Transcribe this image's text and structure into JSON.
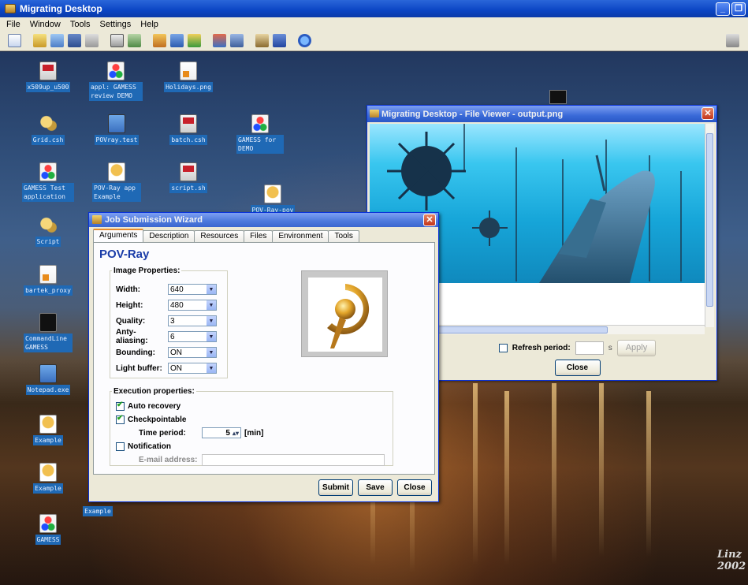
{
  "app": {
    "title": "Migrating Desktop"
  },
  "menu": [
    "File",
    "Window",
    "Tools",
    "Settings",
    "Help"
  ],
  "desktop_icons": [
    {
      "label": "x509up_u500",
      "kind": "pdf"
    },
    {
      "label": "appl: GAMESS review DEMO",
      "kind": "person"
    },
    {
      "label": "Holidays.png",
      "kind": "img"
    },
    {
      "label": "Grid.csh",
      "kind": "puzzle"
    },
    {
      "label": "POVray.test",
      "kind": "note"
    },
    {
      "label": "batch.csh",
      "kind": "pdf"
    },
    {
      "label": "GAMESS for DEMO",
      "kind": "person"
    },
    {
      "label": "GAMESS Test application",
      "kind": "person"
    },
    {
      "label": "POV-Ray app Example",
      "kind": "pov"
    },
    {
      "label": "script.sh",
      "kind": "pdf"
    },
    {
      "label": "POV-Ray-pov",
      "kind": "pov"
    },
    {
      "label": "Script",
      "kind": "puzzle"
    },
    {
      "label": "bartek_proxy",
      "kind": "img"
    },
    {
      "label": "CommandLine GAMESS",
      "kind": "term"
    },
    {
      "label": "Notepad.exe",
      "kind": "note"
    },
    {
      "label": "Example",
      "kind": "pov"
    },
    {
      "label": "Example",
      "kind": "pov"
    },
    {
      "label": "Example",
      "kind": "pov"
    },
    {
      "label": "GAMESS",
      "kind": "person"
    }
  ],
  "file_viewer": {
    "title": "Migrating Desktop - File Viewer - output.png",
    "refresh_label": "Refresh period:",
    "refresh_checked": false,
    "refresh_value": "",
    "unit": "s",
    "apply_label": "Apply",
    "close_label": "Close"
  },
  "wizard": {
    "title": "Job Submission Wizard",
    "tabs": [
      "Arguments",
      "Description",
      "Resources",
      "Files",
      "Environment",
      "Tools"
    ],
    "active_tab": "Arguments",
    "app_name": "POV-Ray",
    "image_props_legend": "Image Properties:",
    "image_props": [
      {
        "label": "Width:",
        "value": "640"
      },
      {
        "label": "Height:",
        "value": "480"
      },
      {
        "label": "Quality:",
        "value": "3"
      },
      {
        "label": "Anty-aliasing:",
        "value": "6"
      },
      {
        "label": "Bounding:",
        "value": "ON"
      },
      {
        "label": "Light buffer:",
        "value": "ON"
      }
    ],
    "exec_legend": "Execution properties:",
    "auto_recovery": {
      "label": "Auto recovery",
      "checked": true
    },
    "checkpointable": {
      "label": "Checkpointable",
      "checked": true
    },
    "time_period": {
      "label": "Time period:",
      "value": "5",
      "unit": "[min]"
    },
    "notification": {
      "label": "Notification",
      "checked": false
    },
    "email": {
      "label": "E-mail address:",
      "value": ""
    },
    "buttons": {
      "submit": "Submit",
      "save": "Save",
      "close": "Close"
    }
  },
  "wallpaper_caption": "Linz 2002"
}
